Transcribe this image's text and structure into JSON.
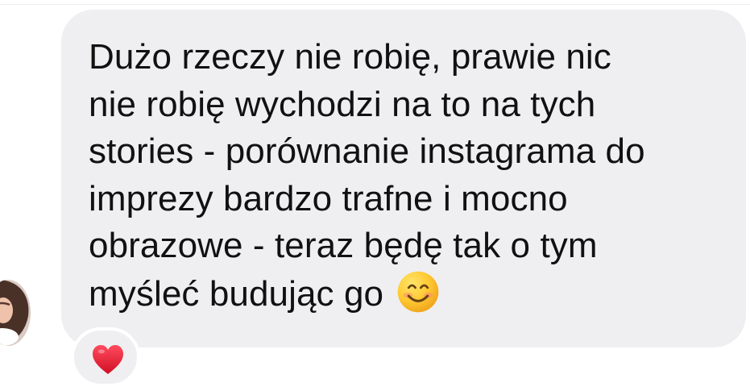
{
  "message": {
    "lines": [
      "Dużo rzeczy nie robię, prawie nic",
      "nie robię wychodzi na to na tych",
      "stories - porównanie instagrama do",
      "imprezy bardzo trafne i mocno",
      "obrazowe - teraz będę tak o tym",
      "myśleć budując go"
    ],
    "emoji": "smiling-face-icon",
    "reaction": "heart-icon"
  },
  "colors": {
    "bubble": "#efeff2",
    "text": "#111111",
    "heart": "#e0112b"
  }
}
